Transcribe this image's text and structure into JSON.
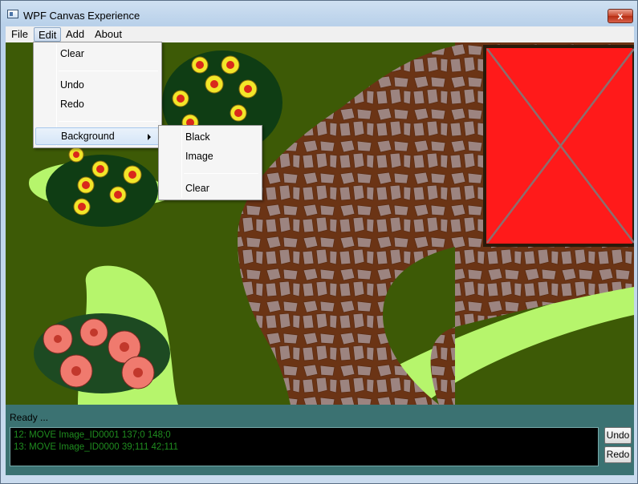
{
  "window": {
    "title": "WPF Canvas Experience",
    "close_label": "x"
  },
  "menubar": {
    "items": [
      "File",
      "Edit",
      "Add",
      "About"
    ],
    "active": "Edit"
  },
  "edit_menu": {
    "items": [
      "Clear",
      "Undo",
      "Redo",
      "Background"
    ]
  },
  "background_submenu": {
    "items": [
      "Black",
      "Image",
      "Clear"
    ]
  },
  "status": {
    "text": "Ready ..."
  },
  "log": {
    "lines": [
      "12: MOVE Image_ID0001 137;0 148;0",
      "13: MOVE Image_ID0000 39;111 42;111"
    ]
  },
  "buttons": {
    "undo": "Undo",
    "redo": "Redo"
  },
  "colors": {
    "grass": "#3d5a06",
    "light_grass": "#b6f56c",
    "path": "#6b3415",
    "stone": "#9c8480",
    "roof": "#ff1a1a",
    "log_text": "#1f8c1f",
    "status_bg": "#3b7272"
  }
}
